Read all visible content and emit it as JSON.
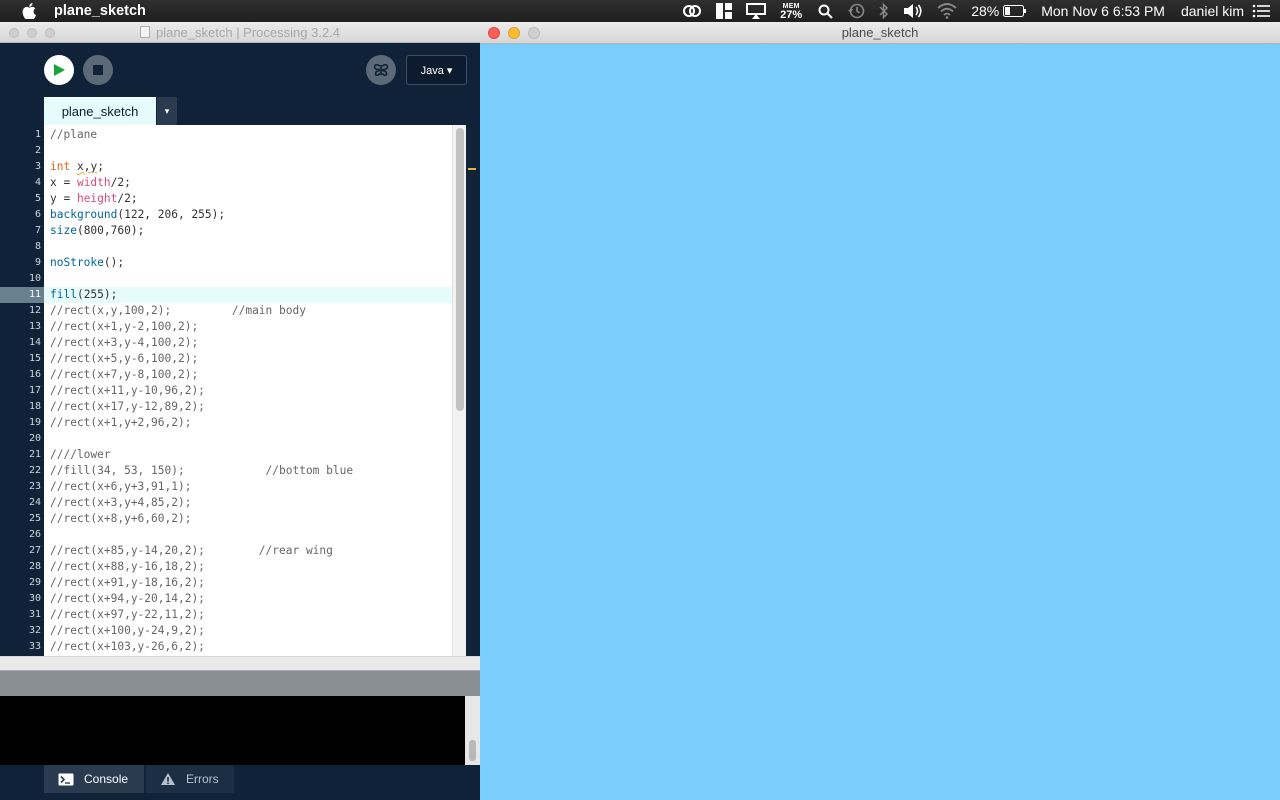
{
  "menubar": {
    "app_name": "plane_sketch",
    "memory_label": "MEM",
    "memory_value": "27%",
    "battery": "28%",
    "datetime": "Mon Nov 6  6:53 PM",
    "user": "daniel kim"
  },
  "ide": {
    "window_title": "plane_sketch | Processing 3.2.4",
    "mode_label": "Java ▾",
    "tab_label": "plane_sketch",
    "tab_menu_arrow": "▾",
    "current_line": 11,
    "code": [
      {
        "n": "1",
        "tokens": [
          {
            "t": "//plane",
            "c": "comment"
          }
        ]
      },
      {
        "n": "2",
        "tokens": []
      },
      {
        "n": "3",
        "tokens": [
          {
            "t": "int",
            "c": "type"
          },
          {
            "t": " ",
            "c": "plain"
          },
          {
            "t": "x,y",
            "c": "plain",
            "squiggle": true
          },
          {
            "t": ";",
            "c": "plain"
          }
        ]
      },
      {
        "n": "4",
        "tokens": [
          {
            "t": "x = ",
            "c": "plain"
          },
          {
            "t": "width",
            "c": "var"
          },
          {
            "t": "/2;",
            "c": "plain"
          }
        ]
      },
      {
        "n": "5",
        "tokens": [
          {
            "t": "y = ",
            "c": "plain"
          },
          {
            "t": "height",
            "c": "var"
          },
          {
            "t": "/2;",
            "c": "plain"
          }
        ]
      },
      {
        "n": "6",
        "tokens": [
          {
            "t": "background",
            "c": "func"
          },
          {
            "t": "(122, 206, 255);",
            "c": "plain"
          }
        ]
      },
      {
        "n": "7",
        "tokens": [
          {
            "t": "size",
            "c": "func"
          },
          {
            "t": "(800,760);",
            "c": "plain"
          }
        ]
      },
      {
        "n": "8",
        "tokens": []
      },
      {
        "n": "9",
        "tokens": [
          {
            "t": "noStroke",
            "c": "func"
          },
          {
            "t": "();",
            "c": "plain"
          }
        ]
      },
      {
        "n": "10",
        "tokens": []
      },
      {
        "n": "11",
        "tokens": [
          {
            "t": "fill",
            "c": "func"
          },
          {
            "t": "(255);",
            "c": "plain"
          }
        ]
      },
      {
        "n": "12",
        "tokens": [
          {
            "t": "//rect(x,y,100,2);         //main body",
            "c": "comment"
          }
        ]
      },
      {
        "n": "13",
        "tokens": [
          {
            "t": "//rect(x+1,y-2,100,2);",
            "c": "comment"
          }
        ]
      },
      {
        "n": "14",
        "tokens": [
          {
            "t": "//rect(x+3,y-4,100,2);",
            "c": "comment"
          }
        ]
      },
      {
        "n": "15",
        "tokens": [
          {
            "t": "//rect(x+5,y-6,100,2);",
            "c": "comment"
          }
        ]
      },
      {
        "n": "16",
        "tokens": [
          {
            "t": "//rect(x+7,y-8,100,2);",
            "c": "comment"
          }
        ]
      },
      {
        "n": "17",
        "tokens": [
          {
            "t": "//rect(x+11,y-10,96,2);",
            "c": "comment"
          }
        ]
      },
      {
        "n": "18",
        "tokens": [
          {
            "t": "//rect(x+17,y-12,89,2);",
            "c": "comment"
          }
        ]
      },
      {
        "n": "19",
        "tokens": [
          {
            "t": "//rect(x+1,y+2,96,2);",
            "c": "comment"
          }
        ]
      },
      {
        "n": "20",
        "tokens": []
      },
      {
        "n": "21",
        "tokens": [
          {
            "t": "////lower",
            "c": "comment"
          }
        ]
      },
      {
        "n": "22",
        "tokens": [
          {
            "t": "//fill(34, 53, 150);            //bottom blue",
            "c": "comment"
          }
        ]
      },
      {
        "n": "23",
        "tokens": [
          {
            "t": "//rect(x+6,y+3,91,1);",
            "c": "comment"
          }
        ]
      },
      {
        "n": "24",
        "tokens": [
          {
            "t": "//rect(x+3,y+4,85,2);",
            "c": "comment"
          }
        ]
      },
      {
        "n": "25",
        "tokens": [
          {
            "t": "//rect(x+8,y+6,60,2);",
            "c": "comment"
          }
        ]
      },
      {
        "n": "26",
        "tokens": []
      },
      {
        "n": "27",
        "tokens": [
          {
            "t": "//rect(x+85,y-14,20,2);        //rear wing",
            "c": "comment"
          }
        ]
      },
      {
        "n": "28",
        "tokens": [
          {
            "t": "//rect(x+88,y-16,18,2);",
            "c": "comment"
          }
        ]
      },
      {
        "n": "29",
        "tokens": [
          {
            "t": "//rect(x+91,y-18,16,2);",
            "c": "comment"
          }
        ]
      },
      {
        "n": "30",
        "tokens": [
          {
            "t": "//rect(x+94,y-20,14,2);",
            "c": "comment"
          }
        ]
      },
      {
        "n": "31",
        "tokens": [
          {
            "t": "//rect(x+97,y-22,11,2);",
            "c": "comment"
          }
        ]
      },
      {
        "n": "32",
        "tokens": [
          {
            "t": "//rect(x+100,y-24,9,2);",
            "c": "comment"
          }
        ]
      },
      {
        "n": "33",
        "tokens": [
          {
            "t": "//rect(x+103,y-26,6,2);",
            "c": "comment"
          }
        ]
      }
    ],
    "console_tab": "Console",
    "errors_tab": "Errors"
  },
  "sketch": {
    "window_title": "plane_sketch",
    "background_color": "#7acefe"
  },
  "colors": {
    "ide_dark": "#0f2238",
    "run_green": "#1aa33a",
    "comment": "#666666",
    "keyword_type": "#e2661a",
    "builtin_var": "#d94a7a",
    "function": "#006699"
  }
}
